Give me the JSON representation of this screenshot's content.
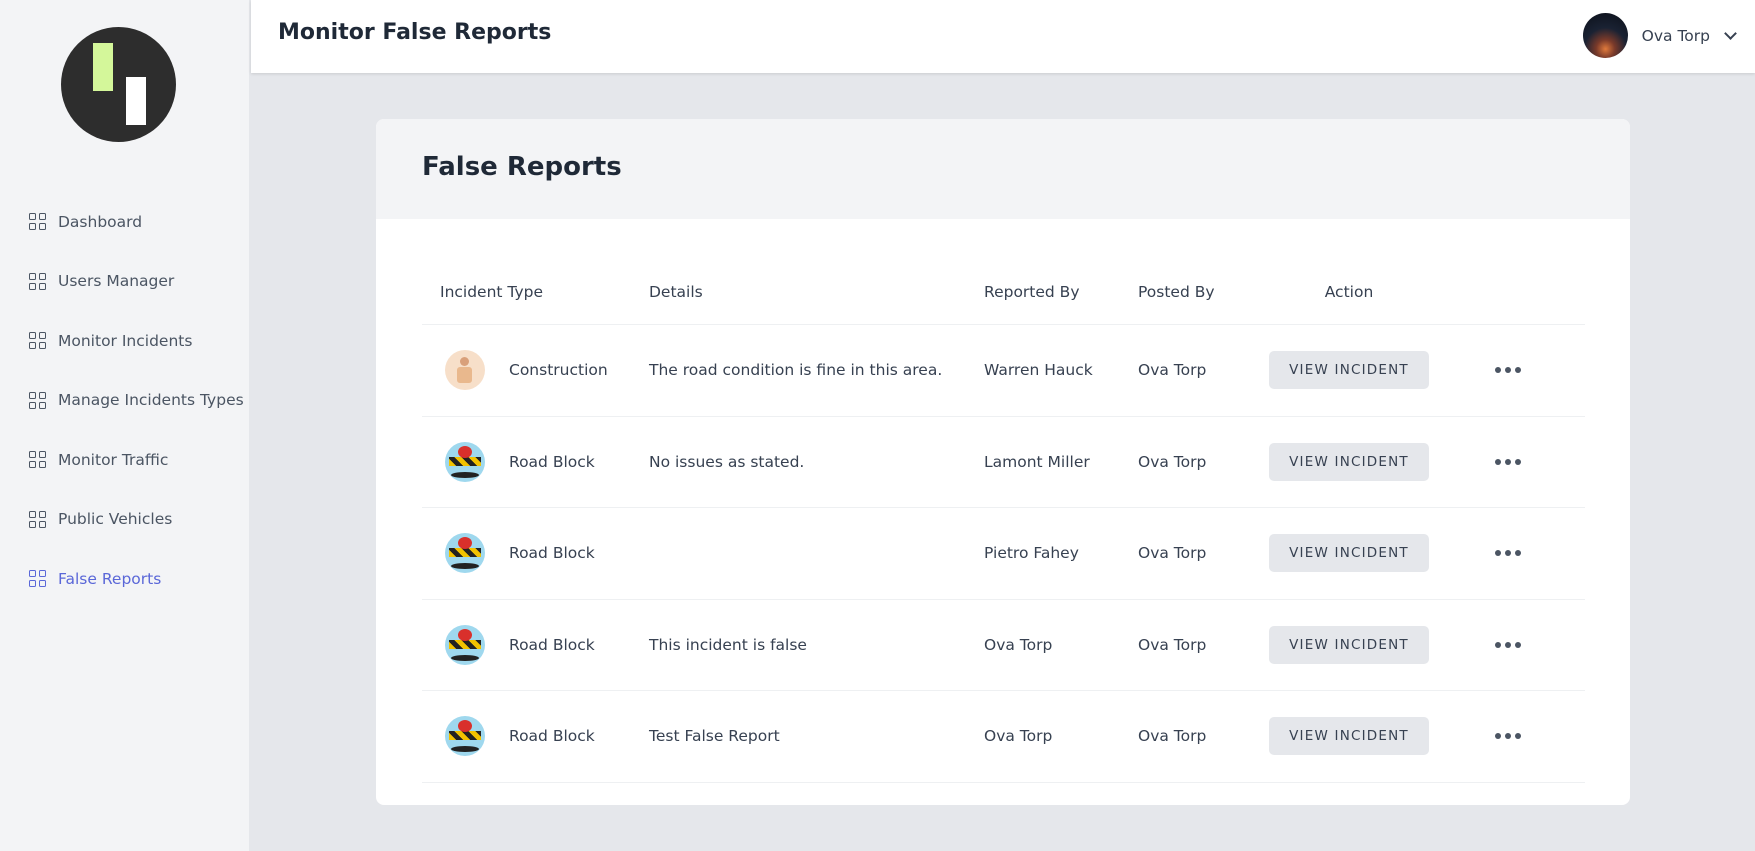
{
  "header": {
    "title": "Monitor False Reports",
    "user_name": "Ova Torp"
  },
  "sidebar": {
    "items": [
      {
        "label": "Dashboard"
      },
      {
        "label": "Users Manager"
      },
      {
        "label": "Monitor Incidents"
      },
      {
        "label": "Manage Incidents Types"
      },
      {
        "label": "Monitor Traffic"
      },
      {
        "label": "Public Vehicles"
      },
      {
        "label": "False Reports"
      }
    ],
    "active_item": "False Reports"
  },
  "card": {
    "title": "False Reports"
  },
  "table": {
    "columns": [
      "Incident Type",
      "Details",
      "Reported By",
      "Posted By",
      "Action"
    ],
    "rows": [
      {
        "icon": "construction-icon",
        "type": "Construction",
        "details": "The road condition is fine in this area.",
        "reported_by": "Warren Hauck",
        "posted_by": "Ova Torp",
        "action": "VIEW INCIDENT"
      },
      {
        "icon": "road-block-icon",
        "type": "Road Block",
        "details": "No issues as stated.",
        "reported_by": "Lamont Miller",
        "posted_by": "Ova Torp",
        "action": "VIEW INCIDENT"
      },
      {
        "icon": "road-block-icon",
        "type": "Road Block",
        "details": "",
        "reported_by": "Pietro Fahey",
        "posted_by": "Ova Torp",
        "action": "VIEW INCIDENT"
      },
      {
        "icon": "road-block-icon",
        "type": "Road Block",
        "details": "This incident is false",
        "reported_by": "Ova Torp",
        "posted_by": "Ova Torp",
        "action": "VIEW INCIDENT"
      },
      {
        "icon": "road-block-icon",
        "type": "Road Block",
        "details": "Test False Report",
        "reported_by": "Ova Torp",
        "posted_by": "Ova Torp",
        "action": "VIEW INCIDENT"
      }
    ]
  },
  "colors": {
    "accent": "#5a67d8",
    "sidebar_bg": "#f3f4f6",
    "page_bg": "#e5e7eb",
    "button_bg": "#e5e7eb"
  }
}
